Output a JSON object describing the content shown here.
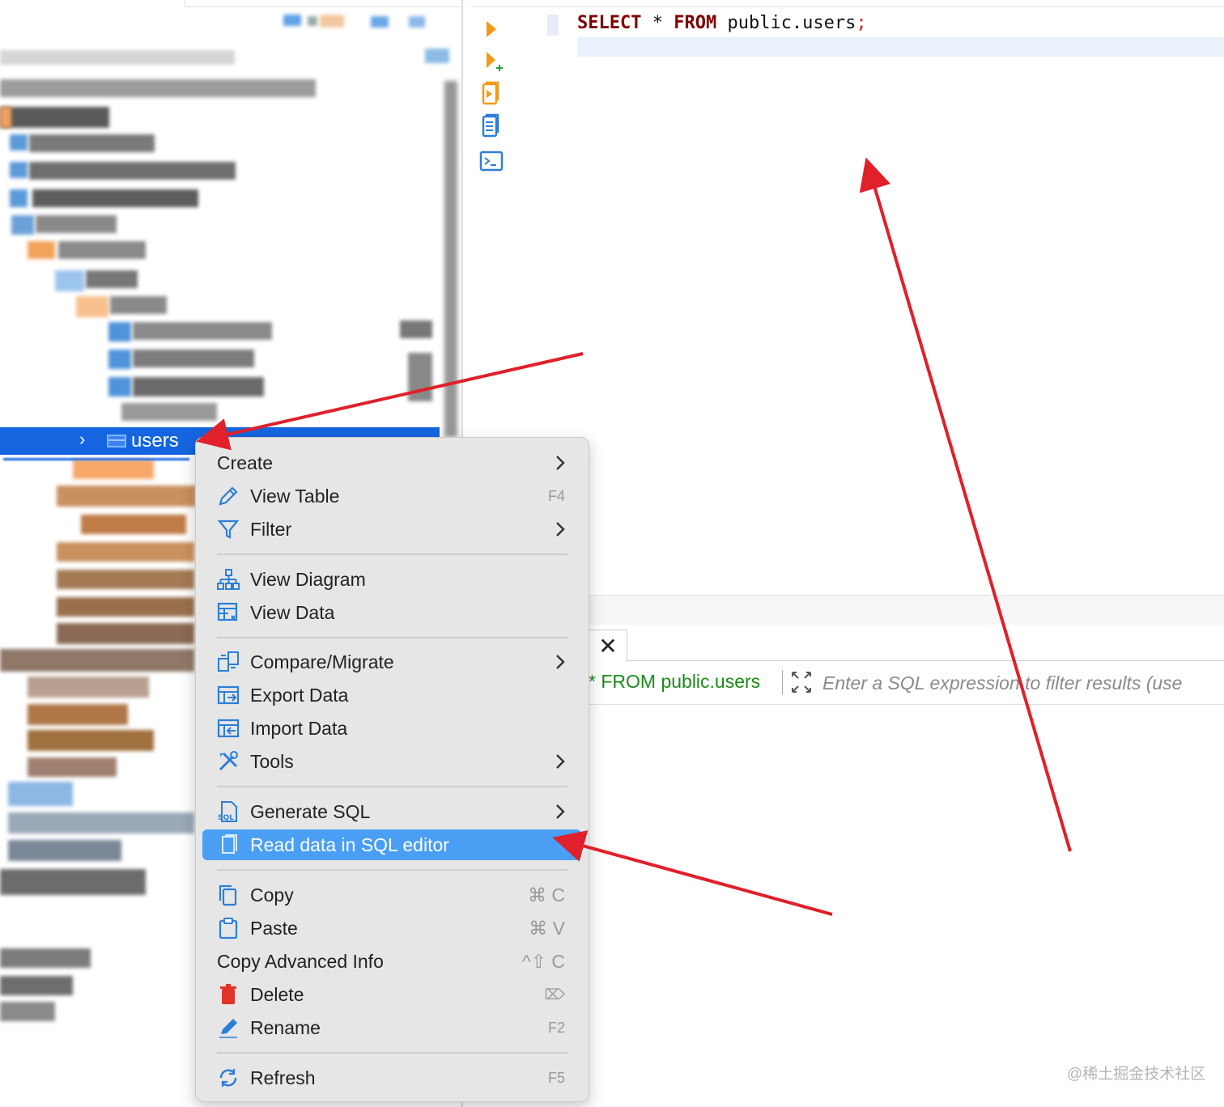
{
  "navigator": {
    "selected_table": "users"
  },
  "editor": {
    "sql": {
      "kw_select": "SELECT",
      "star": " * ",
      "kw_from": "FROM",
      "table": " public.users",
      "semicolon": ";"
    }
  },
  "results": {
    "filter_prefix": "* FROM public.users",
    "filter_placeholder": "Enter a SQL expression to filter results (use"
  },
  "context_menu": {
    "create": "Create",
    "view_table": "View Table",
    "view_table_shortcut": "F4",
    "filter": "Filter",
    "view_diagram": "View Diagram",
    "view_data": "View Data",
    "compare_migrate": "Compare/Migrate",
    "export_data": "Export Data",
    "import_data": "Import Data",
    "tools": "Tools",
    "generate_sql": "Generate SQL",
    "read_data": "Read data in SQL editor",
    "copy": "Copy",
    "copy_shortcut": "⌘ C",
    "paste": "Paste",
    "paste_shortcut": "⌘ V",
    "copy_advanced": "Copy Advanced Info",
    "copy_advanced_shortcut": "^⇧ C",
    "delete": "Delete",
    "delete_shortcut": "⌦",
    "rename": "Rename",
    "rename_shortcut": "F2",
    "refresh": "Refresh",
    "refresh_shortcut": "F5"
  },
  "watermark": "@稀土掘金技术社区",
  "colors": {
    "selection_blue": "#1565e0",
    "menu_highlight": "#4a9ff5",
    "keyword": "#800000",
    "filter_green": "#1b8a1b",
    "annotation_red": "#e0202a",
    "toolbar_orange": "#f39a1b",
    "toolbar_blue": "#2d7ed6"
  }
}
